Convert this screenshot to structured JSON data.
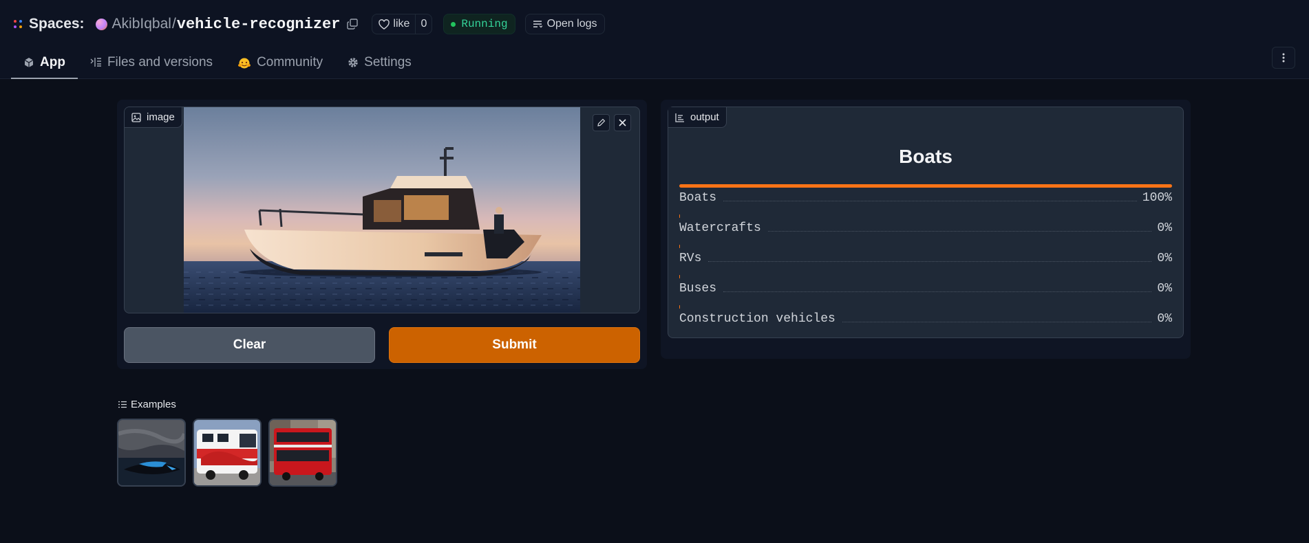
{
  "header": {
    "spaces_label": "Spaces:",
    "owner": "AkibIqbal",
    "separator": "/",
    "repo": "vehicle-recognizer",
    "like_label": "like",
    "like_count": "0",
    "status": "Running",
    "logs_label": "Open logs"
  },
  "tabs": [
    {
      "label": "App",
      "icon": "cube-icon"
    },
    {
      "label": "Files and versions",
      "icon": "files-icon"
    },
    {
      "label": "Community",
      "icon": "community-icon"
    },
    {
      "label": "Settings",
      "icon": "gear-icon"
    }
  ],
  "input": {
    "label": "image",
    "clear_label": "Clear",
    "submit_label": "Submit"
  },
  "output": {
    "label": "output",
    "top_label": "Boats",
    "confidences": [
      {
        "label": "Boats",
        "value": "100%",
        "fraction": 1.0
      },
      {
        "label": "Watercrafts",
        "value": "0%",
        "fraction": 0.0
      },
      {
        "label": "RVs",
        "value": "0%",
        "fraction": 0.0
      },
      {
        "label": "Buses",
        "value": "0%",
        "fraction": 0.0
      },
      {
        "label": "Construction vehicles",
        "value": "0%",
        "fraction": 0.0
      }
    ]
  },
  "examples": {
    "label": "Examples",
    "items": [
      {
        "name": "example-jetski"
      },
      {
        "name": "example-rv"
      },
      {
        "name": "example-double-decker-bus"
      }
    ]
  },
  "colors": {
    "accent": "#f97316",
    "submit": "#cc6200",
    "status_green": "#22c55e",
    "background": "#0b0f19"
  }
}
